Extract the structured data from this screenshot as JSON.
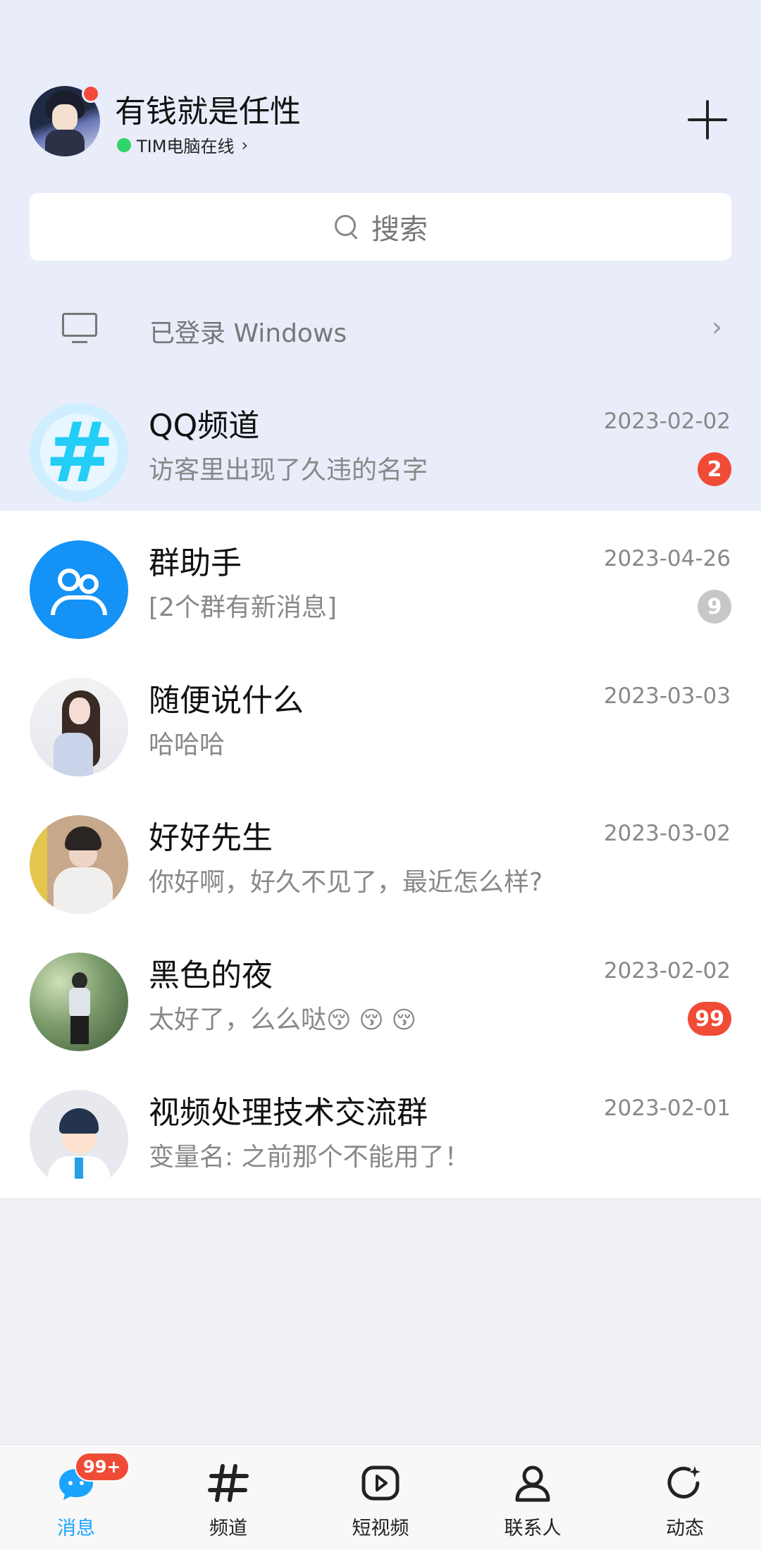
{
  "header": {
    "username": "有钱就是任性",
    "status": "TIM电脑在线",
    "status_chevron": "›"
  },
  "search": {
    "placeholder": "搜索"
  },
  "login_banner": {
    "text": "已登录 Windows",
    "chevron": "›"
  },
  "conversations": [
    {
      "title": "QQ频道",
      "preview": "访客里出现了久违的名字",
      "time": "2023-02-02",
      "badge": "2",
      "badge_color": "#f04b36",
      "avatar": "qq-channel-icon"
    },
    {
      "title": "群助手",
      "preview": "[2个群有新消息]",
      "time": "2023-04-26",
      "badge": "9",
      "badge_color": "#c7c7c7",
      "avatar": "group-helper-icon"
    },
    {
      "title": "随便说什么",
      "preview": "哈哈哈",
      "time": "2023-03-03",
      "badge": "",
      "avatar": "girl-photo"
    },
    {
      "title": "好好先生",
      "preview": "你好啊，好久不见了，最近怎么样?",
      "time": "2023-03-02",
      "badge": "",
      "avatar": "boy-photo"
    },
    {
      "title": "黑色的夜",
      "preview": "太好了，么么哒",
      "preview_emoji": "😚 😚 😚",
      "time": "2023-02-02",
      "badge": "99",
      "badge_color": "#f04b36",
      "avatar": "boy-walking-photo"
    },
    {
      "title": "视频处理技术交流群",
      "preview": "变量名: 之前那个不能用了！",
      "time": "2023-02-01",
      "badge": "",
      "avatar": "default-user-icon"
    }
  ],
  "bottom_nav": {
    "items": [
      {
        "label": "消息",
        "icon": "message-icon",
        "active": true,
        "badge": "99+"
      },
      {
        "label": "频道",
        "icon": "hash-icon",
        "active": false
      },
      {
        "label": "短视频",
        "icon": "short-video-icon",
        "active": false
      },
      {
        "label": "联系人",
        "icon": "contact-icon",
        "active": false
      },
      {
        "label": "动态",
        "icon": "activity-icon",
        "active": false
      }
    ]
  },
  "colors": {
    "accent": "#1aa3ff",
    "badge_red": "#f04b36",
    "top_bg": "#e9edf9"
  }
}
